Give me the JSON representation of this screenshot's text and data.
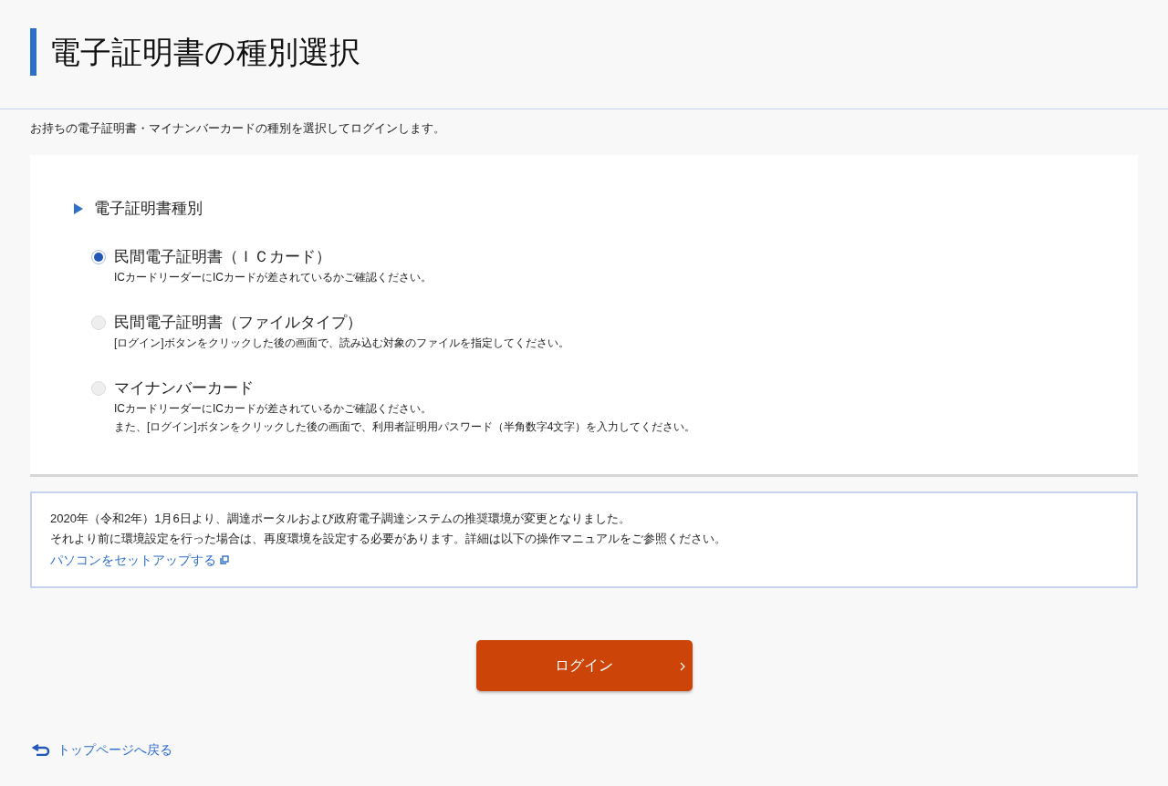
{
  "page_title": "電子証明書の種別選択",
  "intro": "お持ちの電子証明書・マイナンバーカードの種別を選択してログインします。",
  "section": {
    "heading": "電子証明書種別",
    "options": [
      {
        "label": "民間電子証明書（ＩＣカード）",
        "selected": true,
        "notes": [
          "ICカードリーダーにICカードが差されているかご確認ください。"
        ]
      },
      {
        "label": "民間電子証明書（ファイルタイプ）",
        "selected": false,
        "notes": [
          "[ログイン]ボタンをクリックした後の画面で、読み込む対象のファイルを指定してください。"
        ]
      },
      {
        "label": "マイナンバーカード",
        "selected": false,
        "notes": [
          "ICカードリーダーにICカードが差されているかご確認ください。",
          "また、[ログイン]ボタンをクリックした後の画面で、利用者証明用パスワード（半角数字4文字）を入力してください。"
        ]
      }
    ]
  },
  "notice": {
    "lines": [
      "2020年（令和2年）1月6日より、調達ポータルおよび政府電子調達システムの推奨環境が変更となりました。",
      "それより前に環境設定を行った場合は、再度環境を設定する必要があります。詳細は以下の操作マニュアルをご参照ください。"
    ],
    "link": "パソコンをセットアップする"
  },
  "login_button": "ログイン",
  "back_link": "トップページへ戻る"
}
